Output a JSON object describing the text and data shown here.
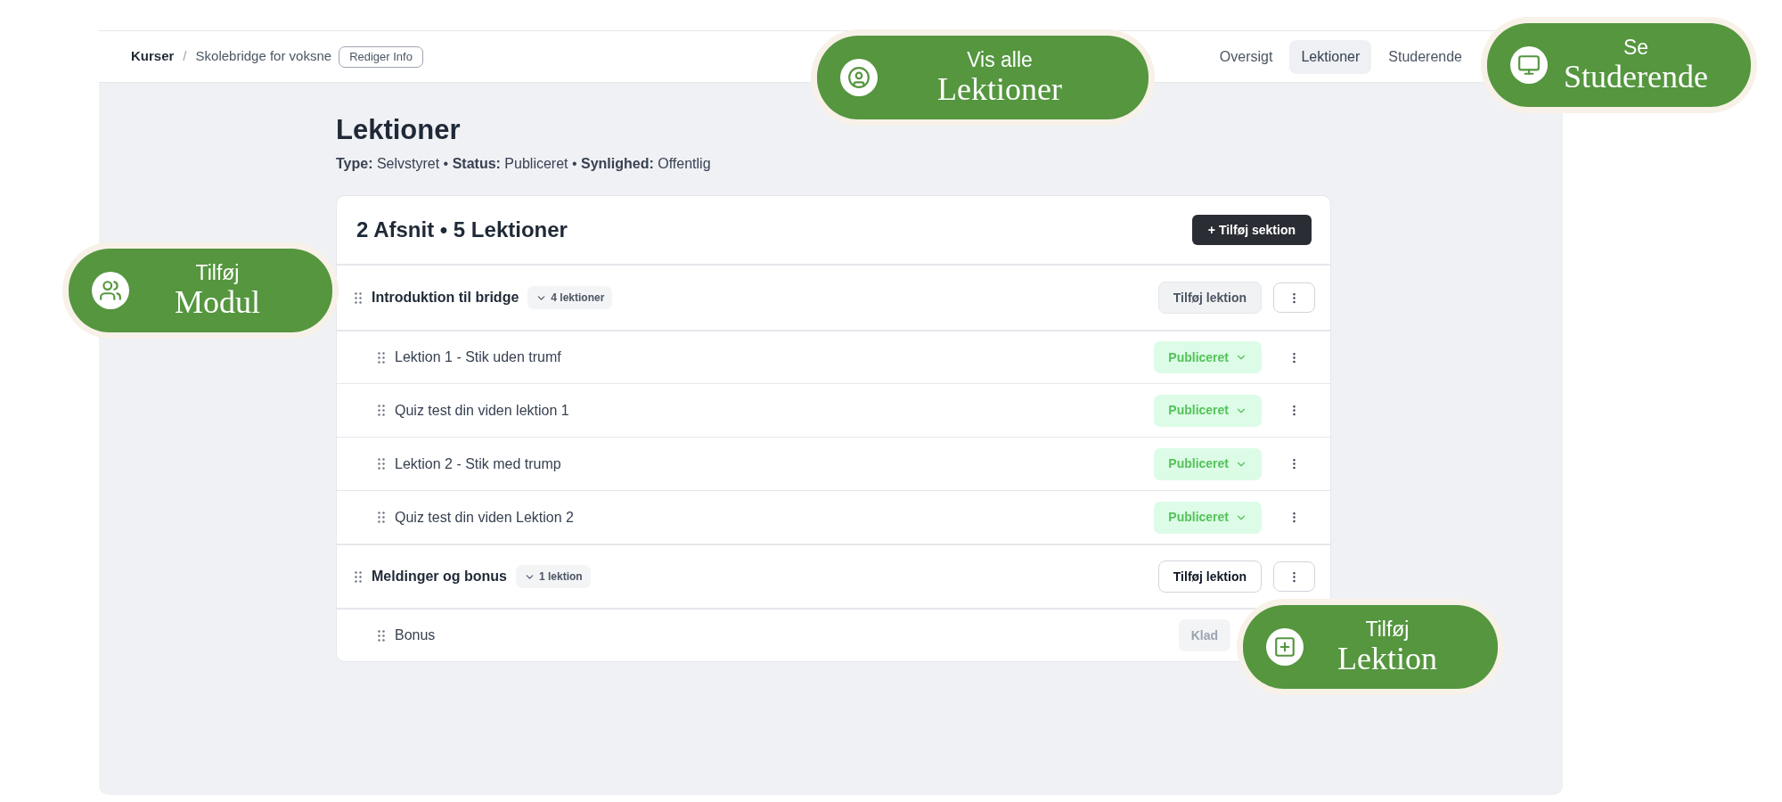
{
  "breadcrumb": {
    "root": "Kurser",
    "separator": "/",
    "current": "Skolebridge for voksne",
    "edit_button": "Rediger Info"
  },
  "nav_tabs": [
    {
      "label": "Oversigt",
      "selected": false
    },
    {
      "label": "Lektioner",
      "selected": true
    },
    {
      "label": "Studerende",
      "selected": false
    }
  ],
  "page_title": "Lektioner",
  "meta": "**Type:** Selvstyret • **Status:** Publiceret • **Synlighed:** Offentlig",
  "card": {
    "title": "2 Afsnit • 5 Lektioner",
    "add_section_button": "+ Tilføj sektion",
    "sections": [
      {
        "title": "Introduktion til bridge",
        "count": "4 lektioner",
        "add_lesson_button": "Tilføj lektion",
        "highlighted": true,
        "lessons": [
          {
            "title": "Lektion 1 - Stik uden trumf",
            "status": "Publiceret",
            "kind": "published"
          },
          {
            "title": "Quiz test din viden lektion 1",
            "status": "Publiceret",
            "kind": "published"
          },
          {
            "title": "Lektion 2 - Stik med trump",
            "status": "Publiceret",
            "kind": "published"
          },
          {
            "title": "Quiz test din viden Lektion 2",
            "status": "Publiceret",
            "kind": "published"
          }
        ]
      },
      {
        "title": "Meldinger og bonus",
        "count": "1 lektion",
        "add_lesson_button": "Tilføj lektion",
        "highlighted": false,
        "lessons": [
          {
            "title": "Bonus",
            "status": "Klad",
            "kind": "draft"
          }
        ]
      }
    ]
  },
  "callouts": [
    {
      "kind": "user",
      "small": "Vis alle",
      "big": "Lektioner"
    },
    {
      "kind": "monitor",
      "small": "Se",
      "big": "Studerende"
    },
    {
      "kind": "group",
      "small": "Tilføj",
      "big": "Modul"
    },
    {
      "kind": "plus",
      "small": "Tilføj",
      "big": "Lektion"
    }
  ]
}
